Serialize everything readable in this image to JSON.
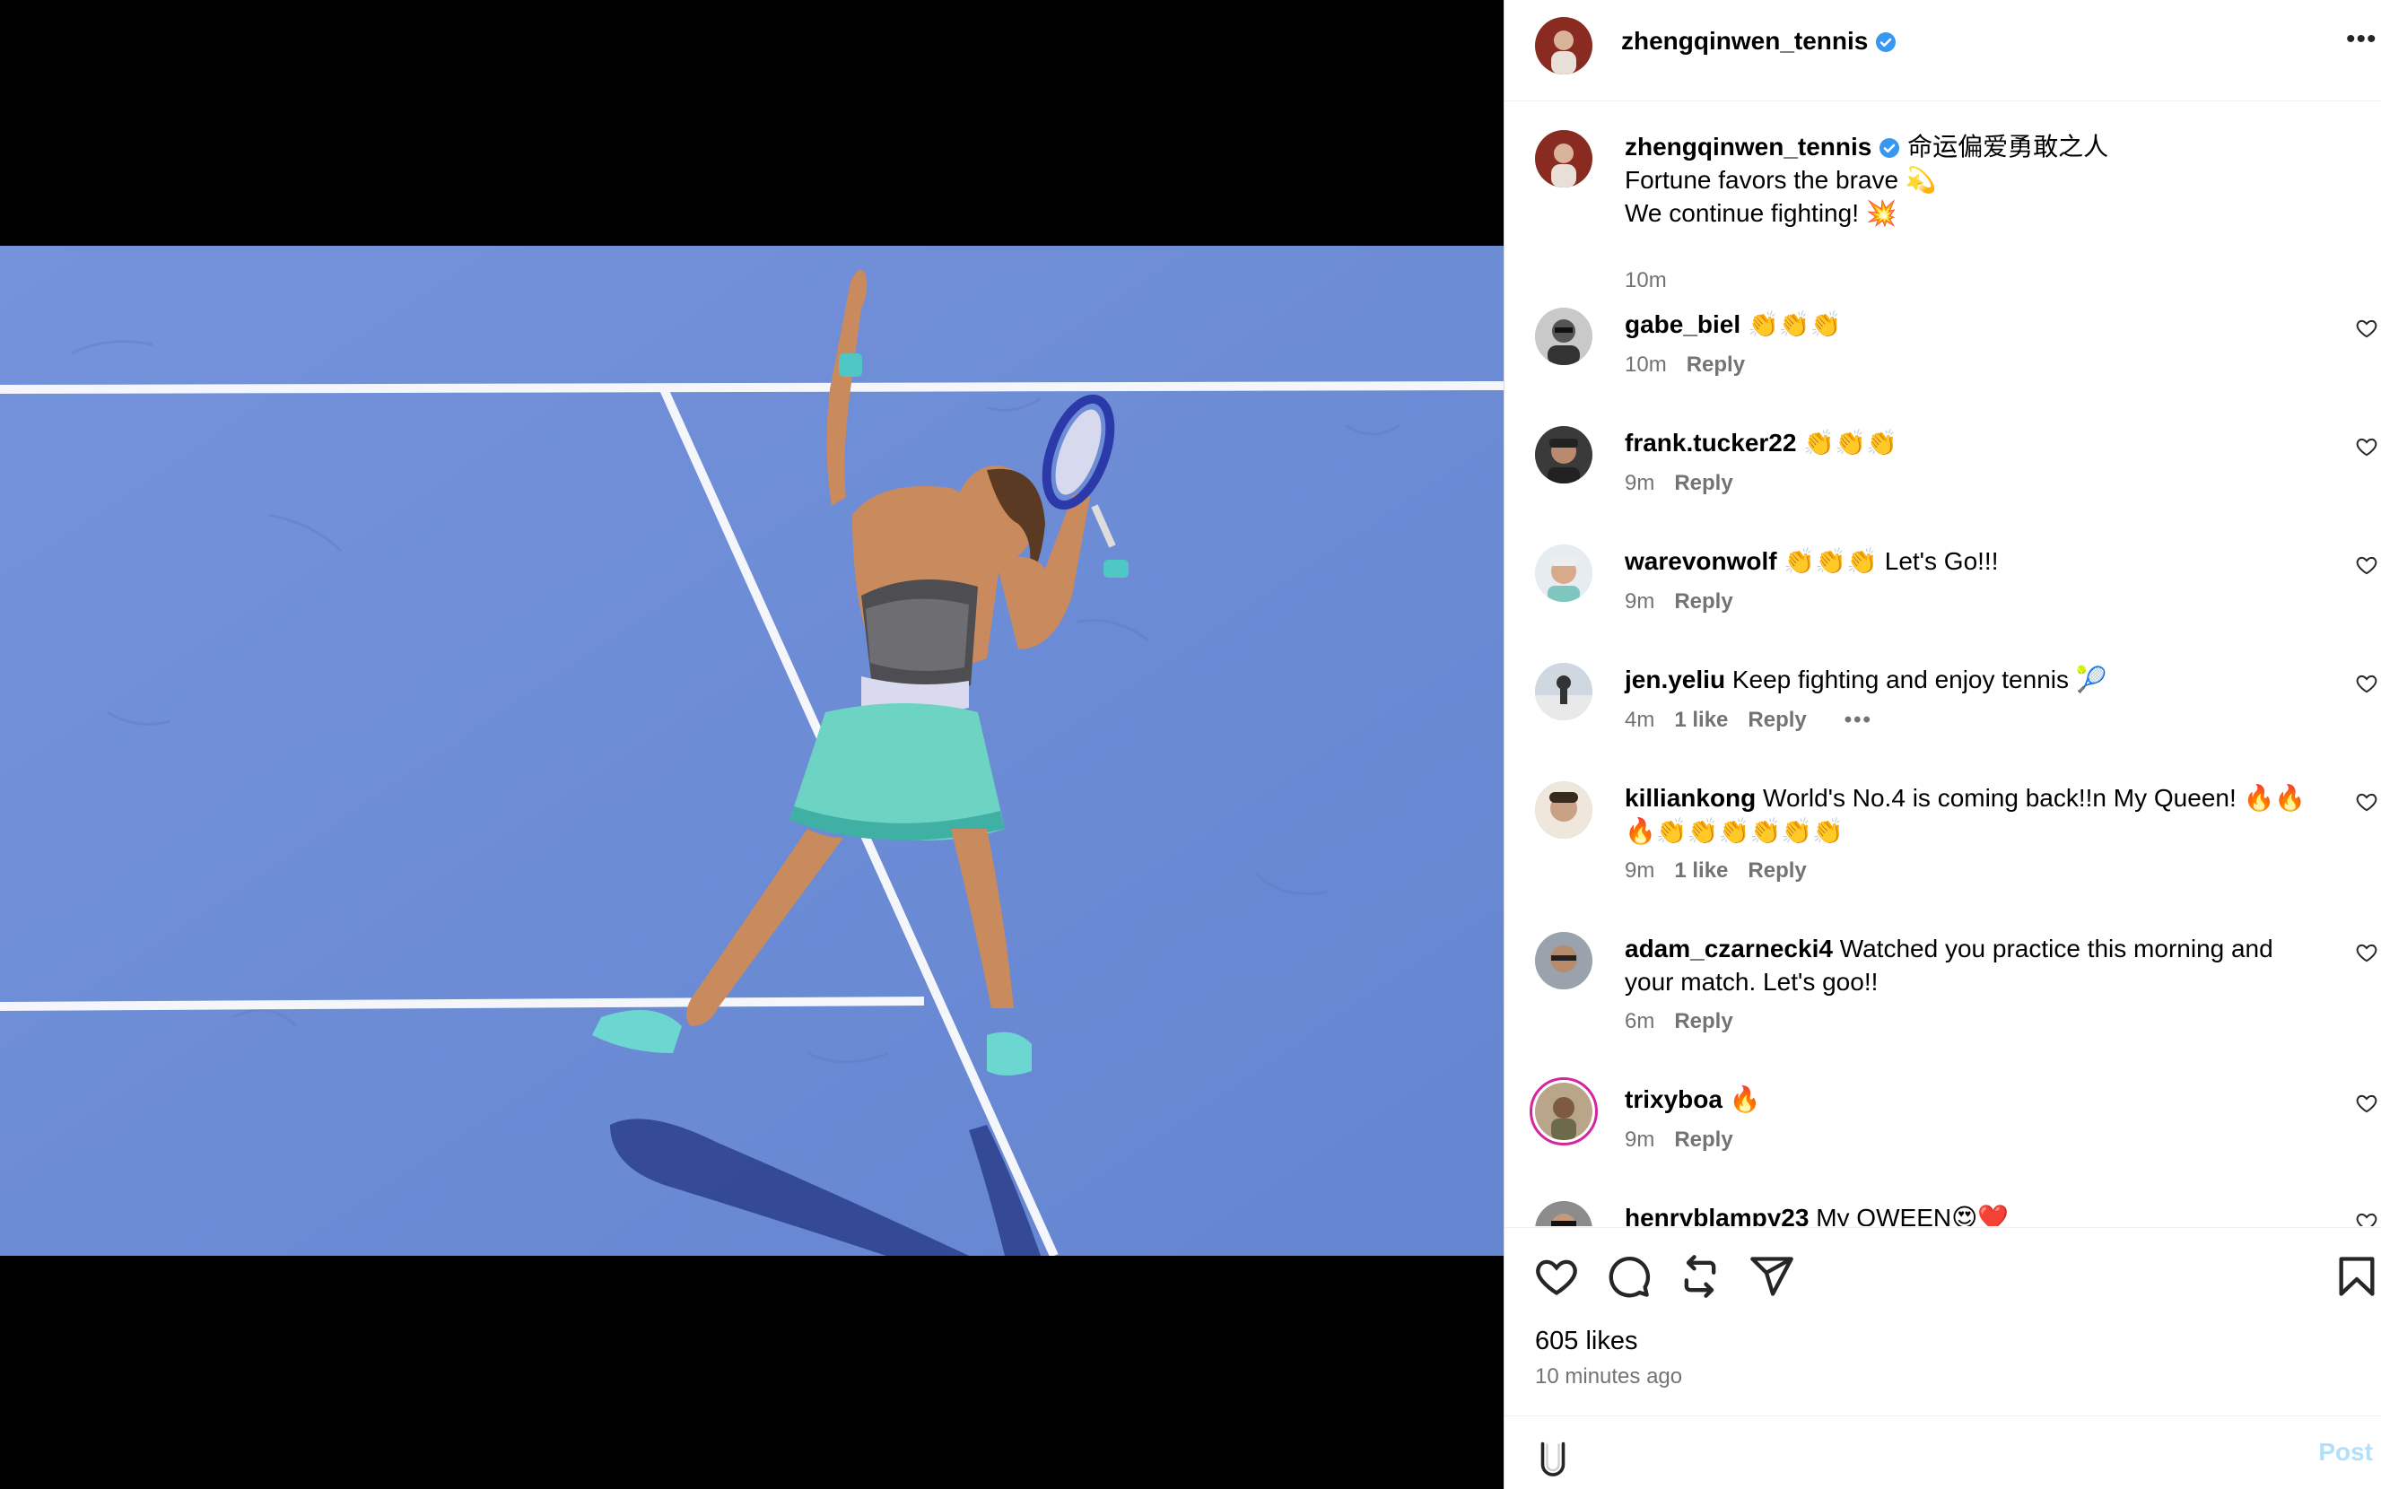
{
  "post": {
    "author": "zhengqinwen_tennis",
    "verified_icon": "verified-badge-icon",
    "caption_line1": "命运偏爱勇敢之人",
    "caption_line2": "Fortune favors the brave 💫",
    "caption_line3": "We continue fighting! 💥",
    "caption_time": "10m",
    "photo_alt": "Tennis player serving on a blue hard court"
  },
  "comments": [
    {
      "user": "gabe_biel",
      "text": "👏👏👏",
      "time": "10m",
      "likes": "",
      "reply": "Reply",
      "more": ""
    },
    {
      "user": "frank.tucker22",
      "text": "👏👏👏",
      "time": "9m",
      "likes": "",
      "reply": "Reply",
      "more": ""
    },
    {
      "user": "warevonwolf",
      "text": "👏👏👏 Let's Go!!!",
      "time": "9m",
      "likes": "",
      "reply": "Reply",
      "more": ""
    },
    {
      "user": "jen.yeliu",
      "text": "Keep fighting and enjoy tennis 🎾",
      "time": "4m",
      "likes": "1 like",
      "reply": "Reply",
      "more": "•••"
    },
    {
      "user": "killiankong",
      "text": "World's No.4 is coming back!!n My Queen! 🔥🔥🔥👏👏👏👏👏👏",
      "time": "9m",
      "likes": "1 like",
      "reply": "Reply",
      "more": ""
    },
    {
      "user": "adam_czarnecki4",
      "text": "Watched you practice this morning and your match. Let's goo!!",
      "time": "6m",
      "likes": "",
      "reply": "Reply",
      "more": ""
    },
    {
      "user": "trixyboa",
      "text": "🔥",
      "time": "9m",
      "likes": "",
      "reply": "Reply",
      "more": ""
    },
    {
      "user": "henryblampy23",
      "text": "My QWEEN😍❤️",
      "time": "",
      "likes": "",
      "reply": "",
      "more": ""
    }
  ],
  "actions": {
    "like_icon": "heart-icon",
    "comment_icon": "comment-icon",
    "repost_icon": "repost-icon",
    "share_icon": "share-icon",
    "save_icon": "bookmark-icon",
    "likes_text": "605 likes",
    "posted_time": "10 minutes ago"
  },
  "composer": {
    "placeholder": "",
    "post_label": "Post",
    "post_color": "#b2dffc",
    "emoji_icon": "emoji-icon"
  },
  "colors": {
    "court": "#6c8bd6",
    "verified": "#3897f0",
    "meta": "#737373"
  }
}
